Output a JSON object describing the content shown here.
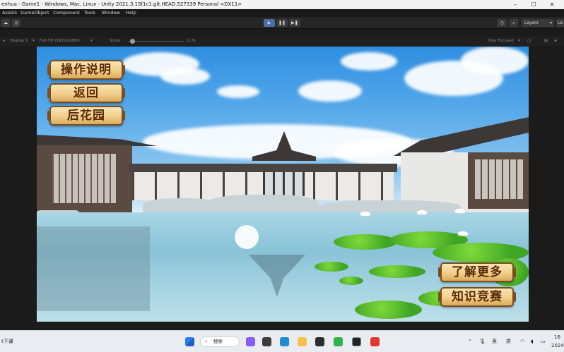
{
  "window": {
    "title": "enhua - Game1 - Windows, Mac, Linux - Unity 2021.3.15f1c1.git.HEAD.527339 Personal <DX11>"
  },
  "menu": [
    "Assets",
    "GameObject",
    "Component",
    "Tools",
    "Window",
    "Help"
  ],
  "toolbar": {
    "layers_label": "Layers",
    "layout_label": "La"
  },
  "game_view": {
    "display": "Display 1",
    "resolution": "Full HD (1920x1080)",
    "scale_label": "Scale",
    "scale_value": "0.7x",
    "play_mode": "Play Focused"
  },
  "game_ui": {
    "buttons_left": [
      "操作说明",
      "返回",
      "后花园"
    ],
    "buttons_right": [
      "了解更多",
      "知识竞赛"
    ]
  },
  "taskbar": {
    "left_text": "t下课",
    "search_label": "搜索",
    "ime_1": "英",
    "ime_2": "拼",
    "time": "16",
    "date": "2024"
  },
  "colors": {
    "sky_top": "#2f8ee0",
    "scroll_button": "#f1cf8a",
    "scroll_text": "#5a2a0b",
    "play_button": "#4a6ea8"
  }
}
